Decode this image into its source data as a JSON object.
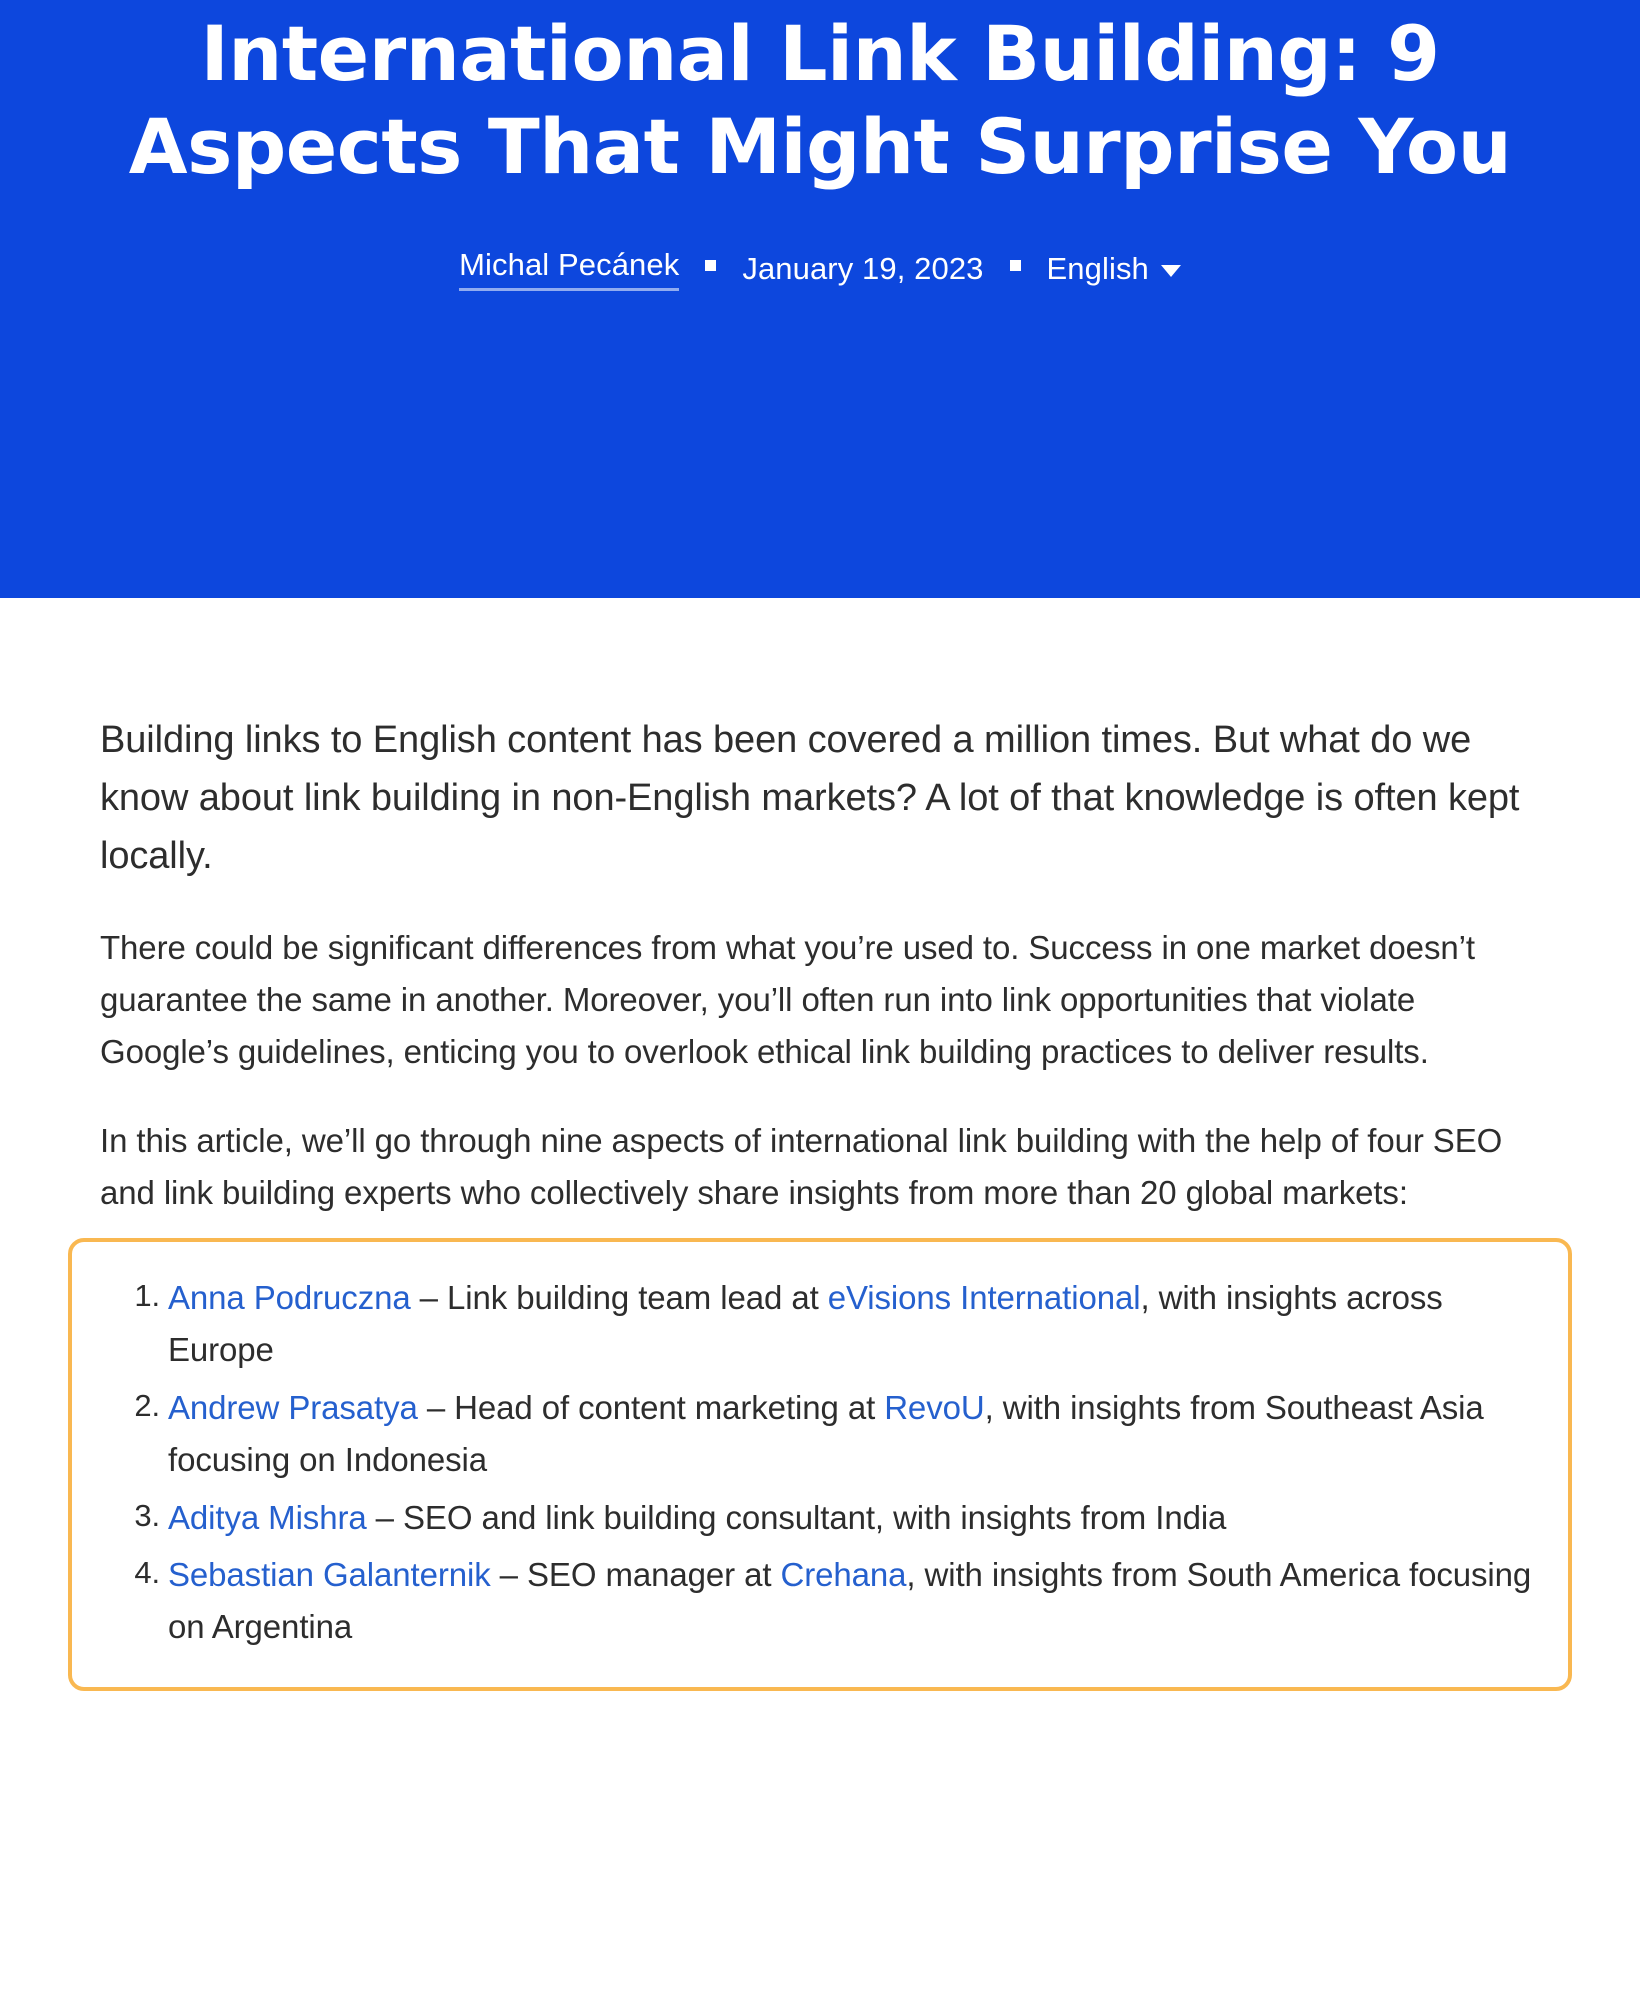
{
  "hero": {
    "title": "International Link Building: 9 Aspects That Might Surprise You",
    "bg_color": "#0d47dd",
    "meta": {
      "author": "Michal Pecánek",
      "separator_icon": "square-bullet",
      "date": "January 19, 2023",
      "language": "English",
      "language_caret_icon": "chevron-down-icon"
    }
  },
  "article": {
    "lead": "Building links to English content has been covered a million times. But what do we know about link building in non-English markets? A lot of that knowledge is often kept locally.",
    "paragraph_2": "There could be significant differences from what you’re used to. Success in one market doesn’t guarantee the same in another. Moreover, you’ll often run into link opportunities that violate Google’s guidelines, enticing you to overlook ethical link building practices to deliver results.",
    "paragraph_3": "In this article, we’ll go through nine aspects of international link building with the help of four SEO and link building experts who collectively share insights from more than 20 global markets:",
    "highlight_box": {
      "border_color": "#f9b851",
      "link_color": "#2560ce",
      "items": [
        {
          "marker": "1.",
          "person": "Anna Podruczna",
          "middle": " – Link building team lead at ",
          "company": "eVisions International",
          "tail": ", with insights across Europe"
        },
        {
          "marker": "2.",
          "person": "Andrew Prasatya",
          "middle": " – Head of content marketing at ",
          "company": "RevoU",
          "tail": ", with insights from Southeast Asia focusing on Indonesia"
        },
        {
          "marker": "3.",
          "person": "Aditya Mishra",
          "middle": " – SEO and link building consultant, with insights from India",
          "company": "",
          "tail": ""
        },
        {
          "marker": "4.",
          "person": "Sebastian Galanternik",
          "middle": " – SEO manager at ",
          "company": "Crehana",
          "tail": ", with insights from South America focusing on Argentina"
        }
      ]
    }
  },
  "colors": {
    "hero_background": "#0d47dd",
    "body_text": "#2d2d2d",
    "link": "#2560ce",
    "highlight_border": "#f9b851",
    "page_background": "#ffffff"
  }
}
